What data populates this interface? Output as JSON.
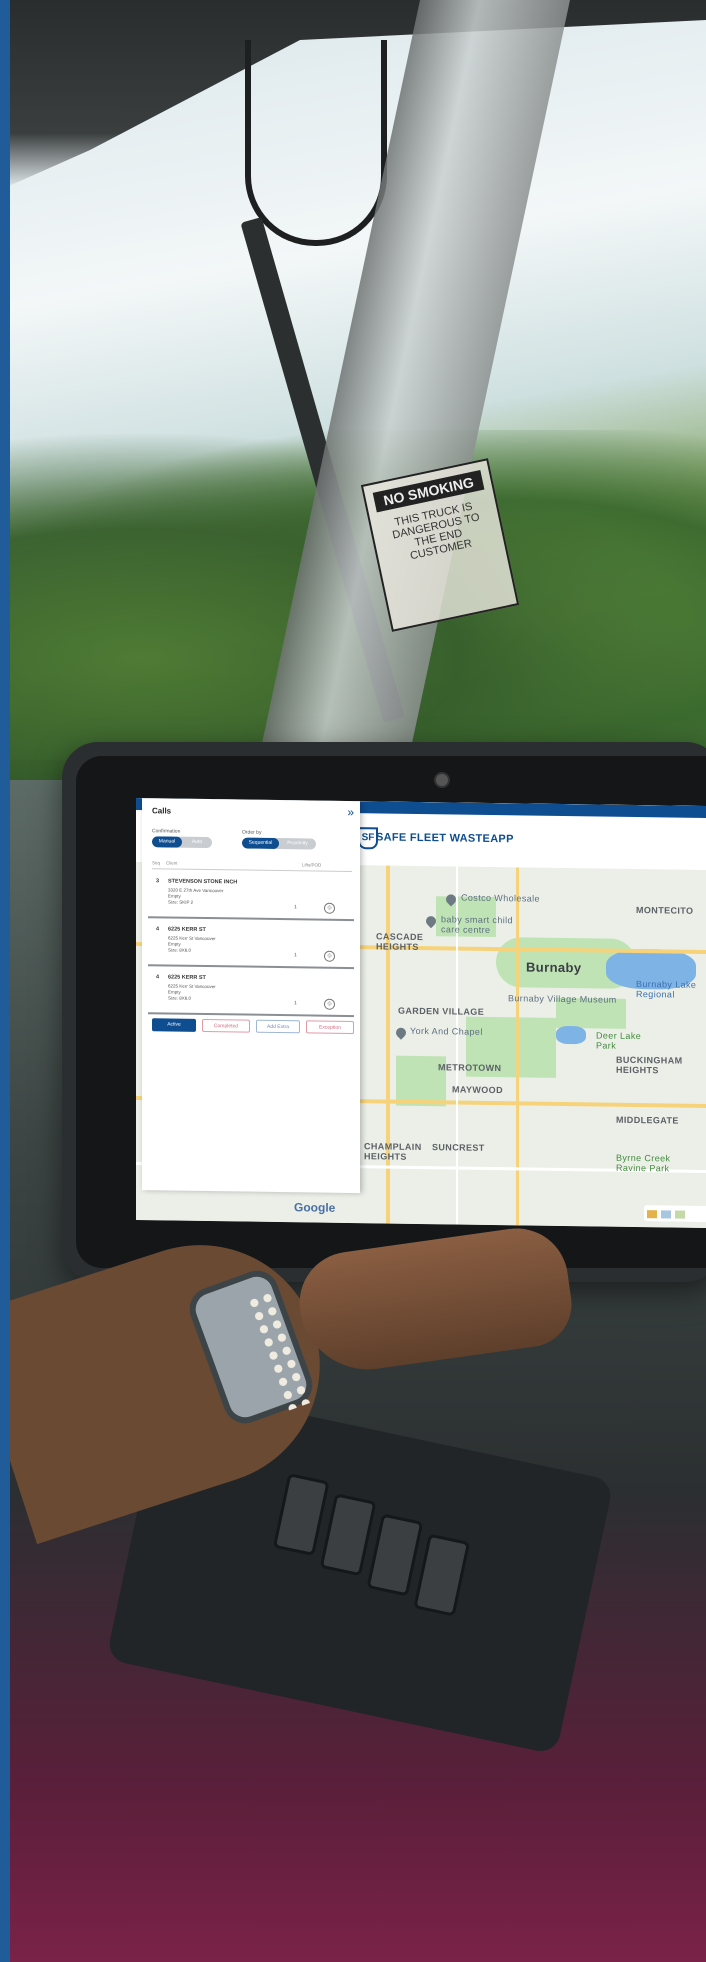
{
  "app": {
    "brand_name": "SAFE FLEET WASTEAPP",
    "logo_letters": "SF",
    "accent_color": "#0e4d90"
  },
  "calls_panel": {
    "title": "Calls",
    "collapse_icon": "double-chevron-right-icon",
    "confirmation_label": "Confirmation",
    "confirmation_options": [
      "Manual",
      "Auto"
    ],
    "confirmation_selected": "Manual",
    "order_by_label": "Order by",
    "order_by_options": [
      "Sequential",
      "Proximity"
    ],
    "order_by_selected": "Sequential",
    "columns": [
      "Seq",
      "Client",
      "Lifts/POD"
    ],
    "items": [
      {
        "seq": "3",
        "name": "STEVENSON STONE INCH",
        "address": "3320 E 27th Ave Vancouver",
        "status": "Empty",
        "size": "Size: SKIP 2",
        "qty": "1"
      },
      {
        "seq": "4",
        "name": "6225 KERR ST",
        "address": "6225 Kerr St Vancouver",
        "status": "Empty",
        "size": "Size: 8X6.0",
        "qty": "1"
      },
      {
        "seq": "4",
        "name": "6225 KERR ST",
        "address": "6225 Kerr St Vancouver",
        "status": "Empty",
        "size": "Size: 8X6.0",
        "qty": "1"
      }
    ],
    "actions": [
      "Active",
      "Completed",
      "Add Extra",
      "Exception"
    ]
  },
  "map": {
    "labels": [
      "Costco Wholesale",
      "baby smart child care centre",
      "MONTECITO",
      "CASCADE HEIGHTS",
      "Burnaby",
      "Burnaby Village Museum",
      "Burnaby Lake Regional",
      "GARDEN VILLAGE",
      "York And Chapel",
      "Deer Lake Park",
      "BUCKINGHAM HEIGHTS",
      "METROTOWN",
      "MAYWOOD",
      "MIDDLEGATE",
      "SUNCREST",
      "CHAMPLAIN HEIGHTS",
      "Byrne Creek Ravine Park"
    ],
    "attribution": "Google"
  },
  "photo": {
    "sticker_heading": "NO SMOKING",
    "sticker_text": "THIS TRUCK IS DANGEROUS TO THE END CUSTOMER"
  }
}
